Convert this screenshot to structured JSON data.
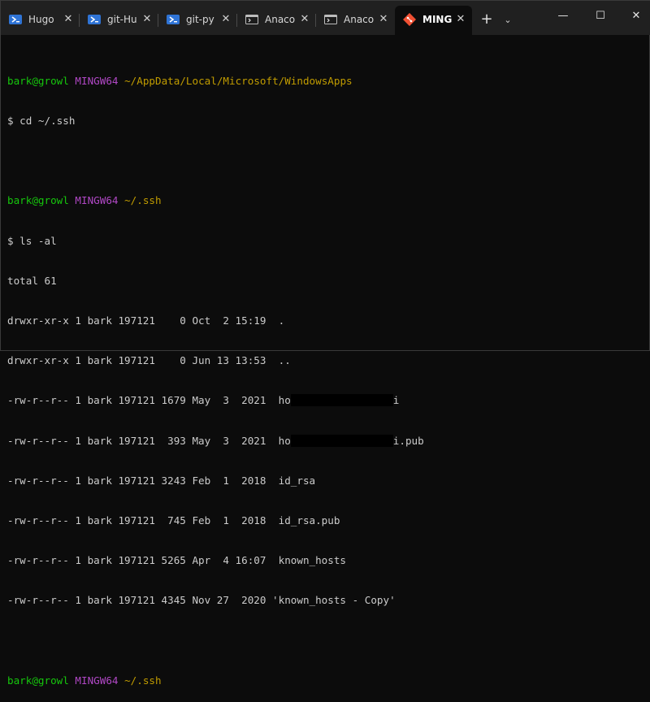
{
  "tabs": [
    {
      "label": "Hugo",
      "icon": "powershell-icon",
      "active": false
    },
    {
      "label": "git-Hu",
      "icon": "powershell-icon",
      "active": false
    },
    {
      "label": "git-py",
      "icon": "powershell-icon",
      "active": false
    },
    {
      "label": "Anaco",
      "icon": "cmd-icon",
      "active": false
    },
    {
      "label": "Anaco",
      "icon": "cmd-icon",
      "active": false
    },
    {
      "label": "MING",
      "icon": "git-icon",
      "active": true
    }
  ],
  "tab_close": "✕",
  "new_tab": "+",
  "dropdown": "⌄",
  "window_controls": {
    "minimize": "—",
    "maximize": "☐",
    "close": "✕"
  },
  "terminal": {
    "prompt1": {
      "user": "bark@growl",
      "host": "MINGW64",
      "path": "~/AppData/Local/Microsoft/WindowsApps"
    },
    "cmd1": "$ cd ~/.ssh",
    "prompt2": {
      "user": "bark@growl",
      "host": "MINGW64",
      "path": "~/.ssh"
    },
    "cmd2": "$ ls -al",
    "total": "total 61",
    "listing": [
      {
        "text": "drwxr-xr-x 1 bark 197121    0 Oct  2 15:19  ."
      },
      {
        "text": "drwxr-xr-x 1 bark 197121    0 Jun 13 13:53  .."
      },
      {
        "text": "-rw-r--r-- 1 bark 197121 1679 May  3  2021  ho",
        "tail": "i"
      },
      {
        "text": "-rw-r--r-- 1 bark 197121  393 May  3  2021  ho",
        "tail": "i.pub"
      },
      {
        "text": "-rw-r--r-- 1 bark 197121 3243 Feb  1  2018  id_rsa"
      },
      {
        "text": "-rw-r--r-- 1 bark 197121  745 Feb  1  2018  id_rsa.pub"
      },
      {
        "text": "-rw-r--r-- 1 bark 197121 5265 Apr  4 16:07  known_hosts"
      },
      {
        "text": "-rw-r--r-- 1 bark 197121 4345 Nov 27  2020 'known_hosts - Copy'"
      }
    ],
    "prompt3": {
      "user": "bark@growl",
      "host": "MINGW64",
      "path": "~/.ssh"
    },
    "cmd3": "$ "
  },
  "colors": {
    "user": "#16c60c",
    "host": "#b148c6",
    "path": "#c19c00",
    "text": "#cccccc",
    "background": "#0c0c0c",
    "tabbar": "#202020"
  }
}
